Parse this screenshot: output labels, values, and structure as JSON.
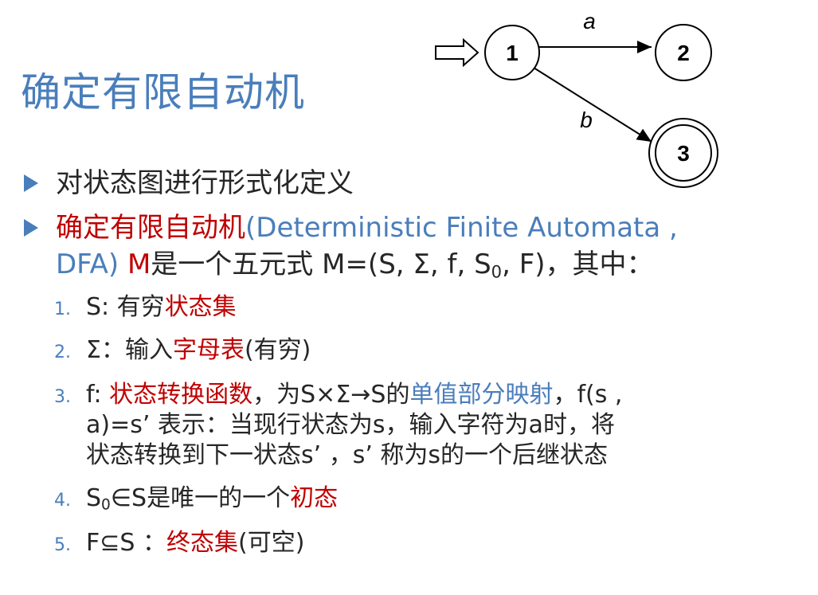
{
  "title": "确定有限自动机",
  "diagram": {
    "states": [
      "1",
      "2",
      "3"
    ],
    "edges": [
      {
        "from": "1",
        "to": "2",
        "label": "a"
      },
      {
        "from": "1",
        "to": "3",
        "label": "b"
      }
    ],
    "start_state": "1",
    "accept_state": "3"
  },
  "bullets": {
    "b1": "对状态图进行形式化定义",
    "b2_red": "确定有限自动机",
    "b2_blue_1": "(Deterministic  Finite  Automata ,",
    "b2_blue_2": "DFA) ",
    "b2_red_m": "M",
    "b2_rest_1": "是一个五元式  M=(S, Σ, f, S",
    "b2_sub0": "0",
    "b2_rest_2": ", F)，其中："
  },
  "items": [
    {
      "num": "1.",
      "pre": "S: 有穷",
      "red": "状态集"
    },
    {
      "num": "2.",
      "pre": "Σ：输入",
      "red": "字母表",
      "post": "(有穷)"
    },
    {
      "num": "3.",
      "pre": "f: ",
      "red": "状态转换函数",
      "mid": "，为S×Σ→S的",
      "blue": "单值部分映射",
      "post": "，f(s ,",
      "line2": "a)=s’  表示：当现行状态为s，输入字符为a时，将",
      "line3": "状态转换到下一状态s’  ，s’ 称为s的一个后继状态"
    },
    {
      "num": "4.",
      "pre": "S",
      "sub": "0",
      "mid": "∈S是唯一的一个",
      "red": "初态"
    },
    {
      "num": "5.",
      "pre": "F⊆S ：",
      "red": "终态集",
      "post": "(可空)"
    }
  ]
}
